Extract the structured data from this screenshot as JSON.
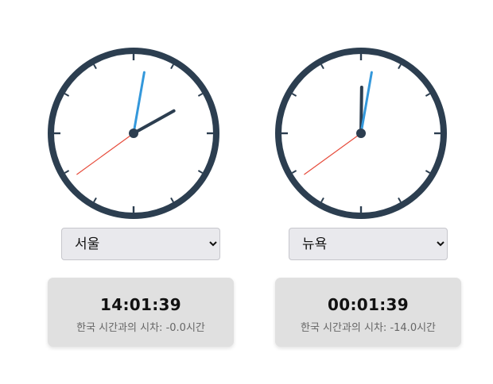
{
  "colors": {
    "clock_rim": "#2c3e50",
    "hour_hand": "#2c3e50",
    "minute_hand": "#3498db",
    "second_hand": "#e74c3c",
    "tick": "#2c3e50",
    "card_bg": "#e0e0e0"
  },
  "clocks": [
    {
      "selected_city": "서울",
      "options": [
        "서울",
        "뉴욕"
      ],
      "time": "14:01:39",
      "diff_label": "한국 시간과의 시차: ",
      "diff_value": "-0.0시간",
      "hands": {
        "hour": 14,
        "minute": 1,
        "second": 39
      }
    },
    {
      "selected_city": "뉴욕",
      "options": [
        "서울",
        "뉴욕"
      ],
      "time": "00:01:39",
      "diff_label": "한국 시간과의 시차: ",
      "diff_value": "-14.0시간",
      "hands": {
        "hour": 0,
        "minute": 1,
        "second": 39
      }
    }
  ]
}
